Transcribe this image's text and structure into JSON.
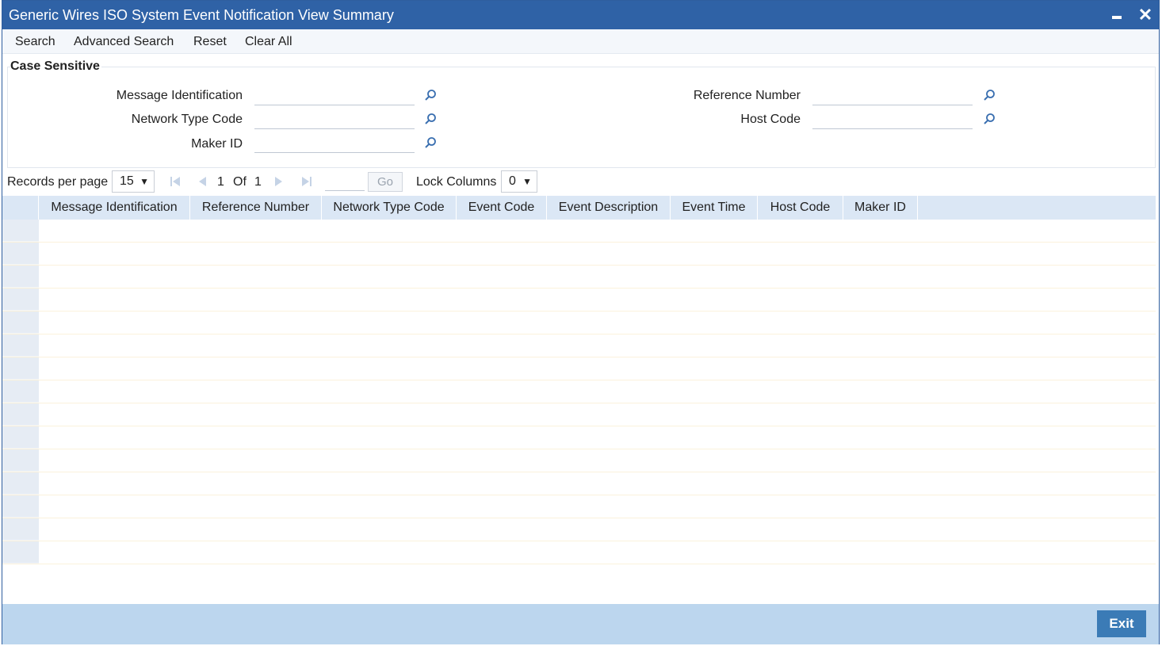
{
  "window": {
    "title": "Generic Wires ISO System Event Notification View Summary"
  },
  "menu": {
    "search": "Search",
    "advanced_search": "Advanced Search",
    "reset": "Reset",
    "clear_all": "Clear All"
  },
  "criteria": {
    "section_title": "Case Sensitive",
    "message_identification": {
      "label": "Message Identification",
      "value": ""
    },
    "network_type_code": {
      "label": "Network Type Code",
      "value": ""
    },
    "maker_id": {
      "label": "Maker ID",
      "value": ""
    },
    "reference_number": {
      "label": "Reference Number",
      "value": ""
    },
    "host_code": {
      "label": "Host Code",
      "value": ""
    }
  },
  "pager": {
    "records_per_page_label": "Records per page",
    "records_per_page": "15",
    "current_page": "1",
    "of_label": "Of",
    "total_pages": "1",
    "go_label": "Go",
    "lock_columns_label": "Lock Columns",
    "lock_columns": "0"
  },
  "grid": {
    "columns": [
      "Message Identification",
      "Reference Number",
      "Network Type Code",
      "Event Code",
      "Event Description",
      "Event Time",
      "Host Code",
      "Maker ID"
    ],
    "rows": []
  },
  "footer": {
    "exit_label": "Exit"
  },
  "colors": {
    "titlebar": "#2f62a6",
    "header_row": "#dbe7f5",
    "footer": "#bcd6ee",
    "exit_button": "#3b7bb6",
    "lens_icon": "#3a6fb0"
  }
}
